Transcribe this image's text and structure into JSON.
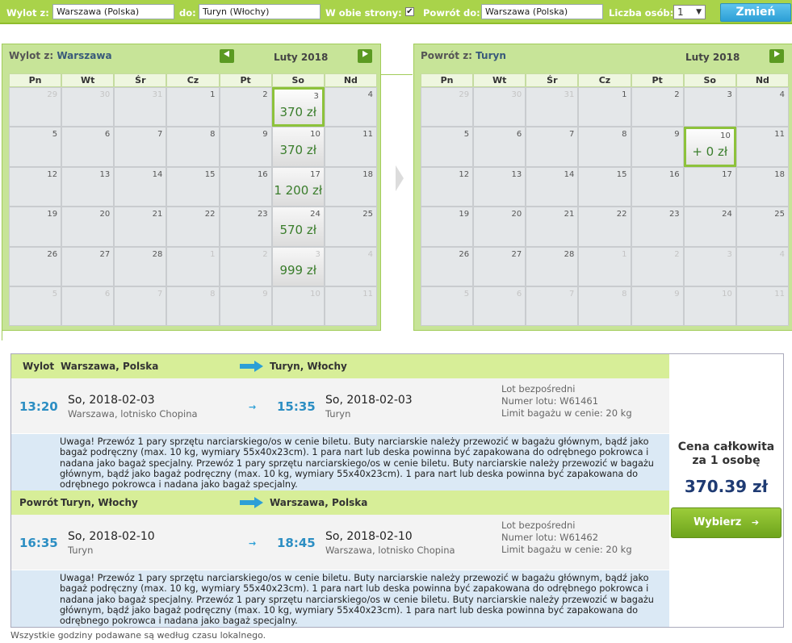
{
  "search": {
    "from_label": "Wylot z:",
    "from_value": "Warszawa (Polska)",
    "to_label": "do:",
    "to_value": "Turyn (Włochy)",
    "roundtrip_label": "W obie strony:",
    "roundtrip_checked": true,
    "return_label": "Powrót do:",
    "return_value": "Warszawa (Polska)",
    "people_label": "Liczba osób:",
    "people_value": "1",
    "submit_label": "Zmień"
  },
  "calendars": {
    "dow": [
      "Pn",
      "Wt",
      "Śr",
      "Cz",
      "Pt",
      "So",
      "Nd"
    ],
    "outbound": {
      "title_prefix": "Wylot z:",
      "title_city": "Warszawa",
      "month": "Luty 2018",
      "weeks": [
        [
          {
            "d": "29",
            "o": true
          },
          {
            "d": "30",
            "o": true
          },
          {
            "d": "31",
            "o": true
          },
          {
            "d": "1"
          },
          {
            "d": "2"
          },
          {
            "d": "3",
            "p": "370 zł",
            "sel": true
          },
          {
            "d": "4"
          }
        ],
        [
          {
            "d": "5"
          },
          {
            "d": "6"
          },
          {
            "d": "7"
          },
          {
            "d": "8"
          },
          {
            "d": "9"
          },
          {
            "d": "10",
            "p": "370 zł"
          },
          {
            "d": "11"
          }
        ],
        [
          {
            "d": "12"
          },
          {
            "d": "13"
          },
          {
            "d": "14"
          },
          {
            "d": "15"
          },
          {
            "d": "16"
          },
          {
            "d": "17",
            "p": "1 200 zł"
          },
          {
            "d": "18"
          }
        ],
        [
          {
            "d": "19"
          },
          {
            "d": "20"
          },
          {
            "d": "21"
          },
          {
            "d": "22"
          },
          {
            "d": "23"
          },
          {
            "d": "24",
            "p": "570 zł"
          },
          {
            "d": "25"
          }
        ],
        [
          {
            "d": "26"
          },
          {
            "d": "27"
          },
          {
            "d": "28"
          },
          {
            "d": "1",
            "o": true
          },
          {
            "d": "2",
            "o": true
          },
          {
            "d": "3",
            "o": true,
            "p": "999 zł"
          },
          {
            "d": "4",
            "o": true
          }
        ],
        [
          {
            "d": "5",
            "o": true
          },
          {
            "d": "6",
            "o": true
          },
          {
            "d": "7",
            "o": true
          },
          {
            "d": "8",
            "o": true
          },
          {
            "d": "9",
            "o": true
          },
          {
            "d": "10",
            "o": true
          },
          {
            "d": "11",
            "o": true
          }
        ]
      ]
    },
    "inbound": {
      "title_prefix": "Powrót z:",
      "title_city": "Turyn",
      "month": "Luty 2018",
      "weeks": [
        [
          {
            "d": "29",
            "o": true
          },
          {
            "d": "30",
            "o": true
          },
          {
            "d": "31",
            "o": true
          },
          {
            "d": "1"
          },
          {
            "d": "2"
          },
          {
            "d": "3"
          },
          {
            "d": "4"
          }
        ],
        [
          {
            "d": "5"
          },
          {
            "d": "6"
          },
          {
            "d": "7"
          },
          {
            "d": "8"
          },
          {
            "d": "9"
          },
          {
            "d": "10",
            "p": "+ 0 zł",
            "sel": true
          },
          {
            "d": "11"
          }
        ],
        [
          {
            "d": "12"
          },
          {
            "d": "13"
          },
          {
            "d": "14"
          },
          {
            "d": "15"
          },
          {
            "d": "16"
          },
          {
            "d": "17"
          },
          {
            "d": "18"
          }
        ],
        [
          {
            "d": "19"
          },
          {
            "d": "20"
          },
          {
            "d": "21"
          },
          {
            "d": "22"
          },
          {
            "d": "23"
          },
          {
            "d": "24"
          },
          {
            "d": "25"
          }
        ],
        [
          {
            "d": "26"
          },
          {
            "d": "27"
          },
          {
            "d": "28"
          },
          {
            "d": "1",
            "o": true
          },
          {
            "d": "2",
            "o": true
          },
          {
            "d": "3",
            "o": true
          },
          {
            "d": "4",
            "o": true
          }
        ],
        [
          {
            "d": "5",
            "o": true
          },
          {
            "d": "6",
            "o": true
          },
          {
            "d": "7",
            "o": true
          },
          {
            "d": "8",
            "o": true
          },
          {
            "d": "9",
            "o": true
          },
          {
            "d": "10",
            "o": true
          },
          {
            "d": "11",
            "o": true
          }
        ]
      ]
    }
  },
  "itinerary": {
    "outbound": {
      "label": "Wylot",
      "from": "Warszawa, Polska",
      "to": "Turyn, Włochy",
      "dep_time": "13:20",
      "dep_date": "So, 2018-02-03",
      "dep_place": "Warszawa, lotnisko Chopina",
      "arr_time": "15:35",
      "arr_date": "So, 2018-02-03",
      "arr_place": "Turyn",
      "info_type": "Lot bezpośredni",
      "info_flight": "Numer lotu: W61461",
      "info_baggage": "Limit bagażu w cenie: 20 kg",
      "notice": "Uwaga! Przewóz 1 pary sprzętu narciarskiego/os w cenie biletu. Buty narciarskie należy przewozić w bagażu głównym, bądź jako bagaż podręczny (max. 10 kg, wymiary 55x40x23cm). 1 para nart lub deska powinna być zapakowana do odrębnego pokrowca i nadana jako bagaż specjalny. Przewóz 1 pary sprzętu narciarskiego/os w cenie biletu. Buty narciarskie należy przewozić w bagażu głównym, bądź jako bagaż podręczny (max. 10 kg, wymiary 55x40x23cm). 1 para nart lub deska powinna być zapakowana do odrębnego pokrowca i nadana jako bagaż specjalny."
    },
    "inbound": {
      "label": "Powrót",
      "from": "Turyn, Włochy",
      "to": "Warszawa, Polska",
      "dep_time": "16:35",
      "dep_date": "So, 2018-02-10",
      "dep_place": "Turyn",
      "arr_time": "18:45",
      "arr_date": "So, 2018-02-10",
      "arr_place": "Warszawa, lotnisko Chopina",
      "info_type": "Lot bezpośredni",
      "info_flight": "Numer lotu: W61462",
      "info_baggage": "Limit bagażu w cenie: 20 kg",
      "notice": "Uwaga! Przewóz 1 pary sprzętu narciarskiego/os w cenie biletu. Buty narciarskie należy przewozić w bagażu głównym, bądź jako bagaż podręczny (max. 10 kg, wymiary 55x40x23cm). 1 para nart lub deska powinna być zapakowana do odrębnego pokrowca i nadana jako bagaż specjalny. Przewóz 1 pary sprzętu narciarskiego/os w cenie biletu. Buty narciarskie należy przewozić w bagażu głównym, bądź jako bagaż podręczny (max. 10 kg, wymiary 55x40x23cm). 1 para nart lub deska powinna być zapakowana do odrębnego pokrowca i nadana jako bagaż specjalny."
    },
    "total_label_line1": "Cena całkowita",
    "total_label_line2": "za 1 osobę",
    "total_price": "370.39 zł",
    "choose_label": "Wybierz",
    "choose_arrow": "➔"
  },
  "footnote": "Wszystkie godziny podawane są według czasu lokalnego.",
  "icons": {
    "prev": "arrow-left-icon",
    "next": "arrow-right-icon",
    "small_arrow": "→"
  },
  "colors": {
    "accent_green": "#a9d34a",
    "price_green": "#3a7d2b",
    "time_blue": "#2c8ec3",
    "total_navy": "#1f3b73"
  }
}
